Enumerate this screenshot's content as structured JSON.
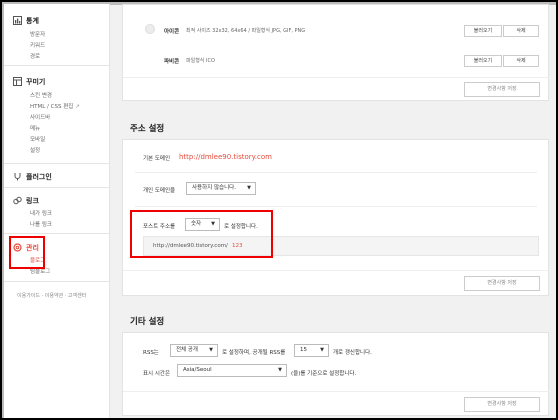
{
  "sidebar": {
    "stats": {
      "title": "통계",
      "items": [
        "방문자",
        "키워드",
        "경로"
      ]
    },
    "decorate": {
      "title": "꾸미기",
      "items": [
        "스킨 변경",
        "HTML / CSS 편집",
        "사이드바",
        "메뉴",
        "모바일",
        "설정"
      ]
    },
    "plugin": {
      "title": "플러그인"
    },
    "link": {
      "title": "링크",
      "items": [
        "내가 링크",
        "나를 링크"
      ]
    },
    "manage": {
      "title": "관리",
      "items": [
        "블로그",
        "팀블로그"
      ]
    },
    "footer": "이용가이드 · 이용약관 · 고객센터"
  },
  "icons_section": {
    "icon_label": "아이콘",
    "icon_desc": "최적 사이즈 32x32, 64x64 / 파일형식 JPG, GIF, PNG",
    "favicon_label": "파비콘",
    "favicon_desc": "파일형식 ICO",
    "load_label": "불러오기",
    "delete_label": "삭제",
    "save_label": "변경사항 저장"
  },
  "address_section": {
    "title": "주소 설정",
    "base_domain_label": "기본 도메인",
    "base_domain_value": "http://dmlee90.tistory.com",
    "personal_domain_label": "개인 도메인을",
    "personal_domain_select": "사용하지 않습니다.",
    "post_address_label": "포스트 주소를",
    "post_address_select": "숫자",
    "post_address_suffix": "로 설정합니다.",
    "post_url_prefix": "http://dmlee90.tistory.com/",
    "post_url_suffix": "123",
    "save_label": "변경사항 저장"
  },
  "other_section": {
    "title": "기타 설정",
    "rss_label": "RSS는",
    "rss_select": "전체 공개",
    "rss_mid": "로 설정하며, 공개될 RSS를",
    "rss_count": "15",
    "rss_suffix": "개로 갱신합니다.",
    "time_label": "표시 시간은",
    "time_select": "Asia/Seoul",
    "time_suffix": "(을)를 기준으로 설정합니다.",
    "save_label": "변경사항 저장"
  }
}
